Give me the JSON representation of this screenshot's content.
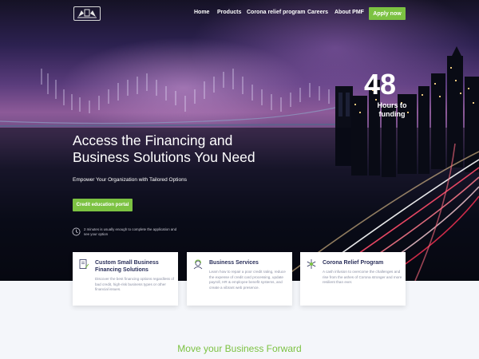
{
  "nav": {
    "logo_icon": "crest-logo-icon",
    "items": [
      "Home",
      "Products",
      "Corona relief program",
      "Careers",
      "About PMF"
    ],
    "apply_label": "Apply now"
  },
  "hero": {
    "headline_line1": "Access the Financing and",
    "headline_line2": "Business Solutions You Need",
    "subheadline": "Empower Your Organization with Tailored Options",
    "cta_label": "Credit education portal",
    "clock_icon": "clock-icon",
    "note": "2 minutes is usually enough to complete the application and see your option",
    "stat_number": "48",
    "stat_label_line1": "Hours to",
    "stat_label_line2": "funding"
  },
  "cards": [
    {
      "icon": "document-pen-icon",
      "title": "Custom Small Business Financing Solutions",
      "description": "Discover the best financing options regardless of bad credit, high-risk business types or other financial issues."
    },
    {
      "icon": "person-support-icon",
      "title": "Business Services",
      "description": "Learn how to repair a poor credit rating, reduce the expense of credit card processing, update payroll, HR & employee benefit systems, and create a vibrant web presence."
    },
    {
      "icon": "snowflake-virus-icon",
      "title": "Corona Relief Program",
      "description": "A cash infusion to overcome the challenges and rise from the ashes of Corona stronger and more resilient than ever."
    }
  ],
  "section": {
    "title": "Move your Business Forward"
  },
  "colors": {
    "accent": "#7cc242",
    "heading_dark": "#2a2f5a",
    "muted": "#8a8fa3"
  }
}
